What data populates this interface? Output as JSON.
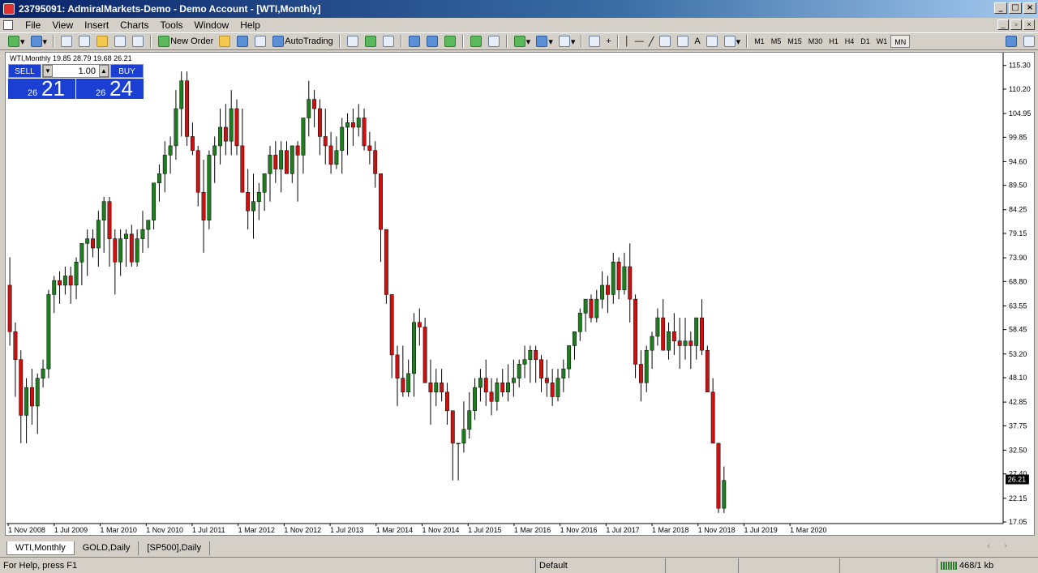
{
  "window": {
    "title": "23795091: AdmiralMarkets-Demo - Demo Account - [WTI,Monthly]"
  },
  "menu": [
    "File",
    "View",
    "Insert",
    "Charts",
    "Tools",
    "Window",
    "Help"
  ],
  "toolbar": {
    "new_order": "New Order",
    "autotrading": "AutoTrading"
  },
  "timeframes": [
    "M1",
    "M5",
    "M15",
    "M30",
    "H1",
    "H4",
    "D1",
    "W1",
    "MN"
  ],
  "active_timeframe": "MN",
  "symbol_line": "WTI,Monthly  19.85 28.79 19.68 26.21",
  "trade": {
    "sell_label": "SELL",
    "buy_label": "BUY",
    "lot": "1.00",
    "sell_small": "26",
    "sell_big": "21",
    "buy_small": "26",
    "buy_big": "24"
  },
  "tabs": [
    "WTI,Monthly",
    "GOLD,Daily",
    "[SP500],Daily"
  ],
  "active_tab": "WTI,Monthly",
  "status": {
    "help": "For Help, press F1",
    "profile": "Default",
    "traffic": "468/1 kb"
  },
  "colors": {
    "bull": "#1e7d1e",
    "bear": "#cc1111",
    "current_price_bg": "#000000"
  },
  "chart_data": {
    "type": "candlestick",
    "title": "WTI,Monthly",
    "ylim": [
      17.05,
      117.0
    ],
    "y_ticks": [
      "115.30",
      "110.20",
      "104.95",
      "99.85",
      "94.60",
      "89.50",
      "84.25",
      "79.15",
      "73.90",
      "68.80",
      "63.55",
      "58.45",
      "53.20",
      "48.10",
      "42.85",
      "37.75",
      "32.50",
      "27.40",
      "22.15",
      "17.05"
    ],
    "x_labels": [
      "1 Nov 2008",
      "1 Jul 2009",
      "1 Mar 2010",
      "1 Nov 2010",
      "1 Jul 2011",
      "1 Mar 2012",
      "1 Nov 2012",
      "1 Jul 2013",
      "1 Mar 2014",
      "1 Nov 2014",
      "1 Jul 2015",
      "1 Mar 2016",
      "1 Nov 2016",
      "1 Jul 2017",
      "1 Mar 2018",
      "1 Nov 2018",
      "1 Jul 2019",
      "1 Mar 2020"
    ],
    "current_price": "26.21",
    "candles": [
      [
        68,
        74,
        55,
        58
      ],
      [
        58,
        60,
        44,
        52
      ],
      [
        52,
        54,
        34,
        40
      ],
      [
        40,
        48,
        34,
        46
      ],
      [
        46,
        50,
        38,
        42
      ],
      [
        42,
        49,
        36,
        48
      ],
      [
        48,
        52,
        46,
        50
      ],
      [
        50,
        67,
        48,
        66
      ],
      [
        66,
        70,
        62,
        69
      ],
      [
        69,
        71,
        64,
        68
      ],
      [
        68,
        72,
        66,
        70
      ],
      [
        70,
        72,
        64,
        68
      ],
      [
        68,
        74,
        65,
        73
      ],
      [
        73,
        76,
        68,
        77
      ],
      [
        77,
        80,
        70,
        78
      ],
      [
        78,
        80,
        74,
        76
      ],
      [
        76,
        84,
        72,
        82
      ],
      [
        82,
        87,
        75,
        86
      ],
      [
        86,
        87,
        72,
        78
      ],
      [
        78,
        80,
        66,
        73
      ],
      [
        73,
        80,
        70,
        78
      ],
      [
        78,
        80,
        72,
        79
      ],
      [
        79,
        81,
        72,
        73
      ],
      [
        73,
        80,
        72,
        78
      ],
      [
        78,
        84,
        75,
        80
      ],
      [
        80,
        82,
        76,
        82
      ],
      [
        82,
        88,
        80,
        90
      ],
      [
        90,
        94,
        86,
        92
      ],
      [
        92,
        99,
        88,
        96
      ],
      [
        96,
        100,
        92,
        98
      ],
      [
        98,
        110,
        95,
        106
      ],
      [
        106,
        114,
        100,
        112
      ],
      [
        112,
        114,
        98,
        100
      ],
      [
        100,
        103,
        96,
        97
      ],
      [
        97,
        98,
        85,
        88
      ],
      [
        88,
        95,
        75,
        82
      ],
      [
        82,
        97,
        80,
        96
      ],
      [
        96,
        100,
        90,
        98
      ],
      [
        98,
        106,
        94,
        102
      ],
      [
        102,
        107,
        96,
        99
      ],
      [
        99,
        110,
        96,
        106
      ],
      [
        106,
        108,
        96,
        98
      ],
      [
        98,
        106,
        92,
        88
      ],
      [
        88,
        93,
        80,
        84
      ],
      [
        84,
        92,
        78,
        86
      ],
      [
        86,
        90,
        82,
        88
      ],
      [
        88,
        92,
        84,
        92
      ],
      [
        92,
        98,
        86,
        96
      ],
      [
        96,
        99,
        90,
        93
      ],
      [
        93,
        99,
        88,
        97
      ],
      [
        97,
        99,
        92,
        92
      ],
      [
        92,
        98,
        90,
        98
      ],
      [
        98,
        99,
        86,
        96
      ],
      [
        96,
        104,
        92,
        104
      ],
      [
        104,
        112,
        100,
        108
      ],
      [
        108,
        110,
        102,
        106
      ],
      [
        106,
        108,
        96,
        100
      ],
      [
        100,
        106,
        94,
        98
      ],
      [
        98,
        101,
        92,
        94
      ],
      [
        94,
        100,
        93,
        97
      ],
      [
        97,
        104,
        92,
        102
      ],
      [
        102,
        105,
        96,
        103
      ],
      [
        103,
        106,
        98,
        102
      ],
      [
        102,
        107,
        100,
        104
      ],
      [
        104,
        106,
        97,
        98
      ],
      [
        98,
        101,
        94,
        97
      ],
      [
        97,
        99,
        89,
        92
      ],
      [
        92,
        92,
        73,
        80
      ],
      [
        80,
        80,
        64,
        66
      ],
      [
        66,
        62,
        48,
        53
      ],
      [
        53,
        55,
        42,
        48
      ],
      [
        48,
        55,
        44,
        45
      ],
      [
        45,
        52,
        44,
        49
      ],
      [
        49,
        62,
        44,
        60
      ],
      [
        60,
        63,
        55,
        59
      ],
      [
        59,
        61,
        50,
        47
      ],
      [
        47,
        52,
        38,
        45
      ],
      [
        45,
        50,
        42,
        47
      ],
      [
        47,
        50,
        43,
        45
      ],
      [
        45,
        47,
        38,
        41
      ],
      [
        41,
        41,
        26,
        34
      ],
      [
        34,
        33,
        26,
        34
      ],
      [
        34,
        43,
        32,
        37
      ],
      [
        37,
        45,
        35,
        41
      ],
      [
        41,
        48,
        39,
        46
      ],
      [
        46,
        50,
        43,
        48
      ],
      [
        48,
        52,
        42,
        45
      ],
      [
        45,
        48,
        40,
        43
      ],
      [
        43,
        48,
        41,
        47
      ],
      [
        47,
        50,
        44,
        45
      ],
      [
        45,
        51,
        43,
        47
      ],
      [
        47,
        52,
        44,
        48
      ],
      [
        48,
        52,
        46,
        51
      ],
      [
        51,
        55,
        48,
        52
      ],
      [
        52,
        55,
        47,
        54
      ],
      [
        54,
        55,
        47,
        52
      ],
      [
        52,
        53,
        45,
        48
      ],
      [
        48,
        52,
        44,
        47
      ],
      [
        47,
        50,
        42,
        44
      ],
      [
        44,
        50,
        43,
        48
      ],
      [
        48,
        52,
        45,
        50
      ],
      [
        50,
        54,
        48,
        55
      ],
      [
        55,
        58,
        52,
        58
      ],
      [
        58,
        63,
        56,
        62
      ],
      [
        62,
        65,
        58,
        65
      ],
      [
        65,
        66,
        60,
        61
      ],
      [
        61,
        67,
        60,
        65
      ],
      [
        65,
        71,
        63,
        68
      ],
      [
        68,
        70,
        62,
        66
      ],
      [
        66,
        75,
        64,
        73
      ],
      [
        73,
        74,
        65,
        67
      ],
      [
        67,
        75,
        66,
        72
      ],
      [
        72,
        77,
        60,
        65
      ],
      [
        65,
        66,
        48,
        51
      ],
      [
        51,
        54,
        43,
        47
      ],
      [
        47,
        55,
        45,
        54
      ],
      [
        54,
        58,
        50,
        57
      ],
      [
        57,
        63,
        55,
        61
      ],
      [
        61,
        65,
        54,
        54
      ],
      [
        54,
        60,
        52,
        58
      ],
      [
        58,
        62,
        53,
        56
      ],
      [
        56,
        61,
        50,
        55
      ],
      [
        55,
        61,
        52,
        56
      ],
      [
        56,
        58,
        50,
        55
      ],
      [
        55,
        60,
        52,
        61
      ],
      [
        61,
        65,
        53,
        54
      ],
      [
        54,
        55,
        45,
        45
      ],
      [
        45,
        48,
        34,
        34
      ],
      [
        34,
        25,
        19,
        20
      ],
      [
        20,
        29,
        19,
        26
      ]
    ]
  }
}
